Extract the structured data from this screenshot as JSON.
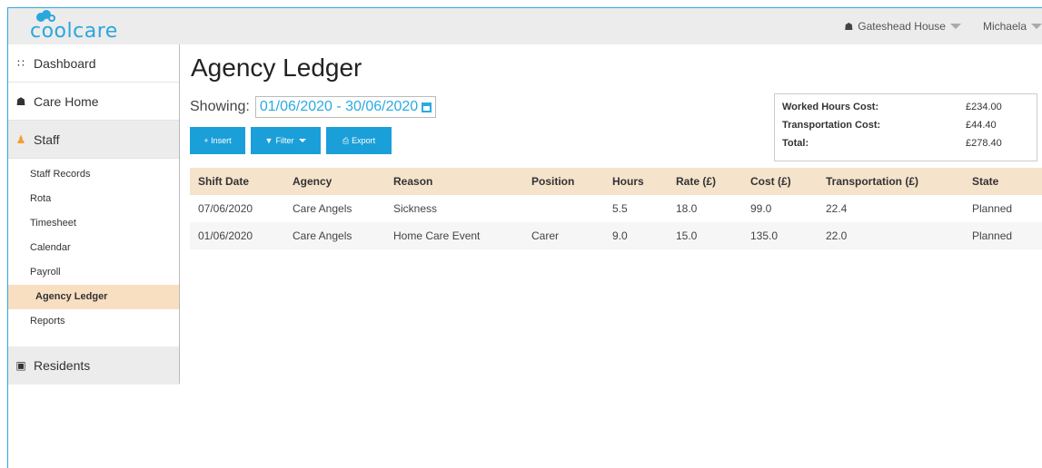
{
  "app": {
    "logo_text": "coolcare"
  },
  "topbar": {
    "home_name": "Gateshead House",
    "user_name": "Michaela"
  },
  "sidebar": {
    "dashboard": "Dashboard",
    "care_home": "Care Home",
    "staff": "Staff",
    "staff_items": [
      "Staff Records",
      "Rota",
      "Timesheet",
      "Calendar",
      "Payroll",
      "Agency Ledger",
      "Reports"
    ],
    "active_item": "Agency Ledger",
    "residents": "Residents"
  },
  "main": {
    "title": "Agency Ledger",
    "showing_label": "Showing:",
    "date_range": "01/06/2020 - 30/06/2020",
    "buttons": {
      "insert": "+ Insert",
      "filter": "Filter",
      "export": "Export"
    },
    "summary": {
      "worked_label": "Worked Hours Cost:",
      "worked_value": "£234.00",
      "transport_label": "Transportation Cost:",
      "transport_value": "£44.40",
      "total_label": "Total:",
      "total_value": "£278.40"
    },
    "table": {
      "headers": [
        "Shift Date",
        "Agency",
        "Reason",
        "Position",
        "Hours",
        "Rate (£)",
        "Cost (£)",
        "Transportation (£)",
        "State"
      ],
      "rows": [
        [
          "07/06/2020",
          "Care Angels",
          "Sickness",
          "",
          "5.5",
          "18.0",
          "99.0",
          "22.4",
          "Planned"
        ],
        [
          "01/06/2020",
          "Care Angels",
          "Home Care Event",
          "Carer",
          "9.0",
          "15.0",
          "135.0",
          "22.0",
          "Planned"
        ]
      ]
    }
  },
  "colors": {
    "accent": "#1b9fd8",
    "active_nav": "#f9dfc2",
    "table_header": "#f5e3cc",
    "staff_icon": "#f0a030"
  }
}
